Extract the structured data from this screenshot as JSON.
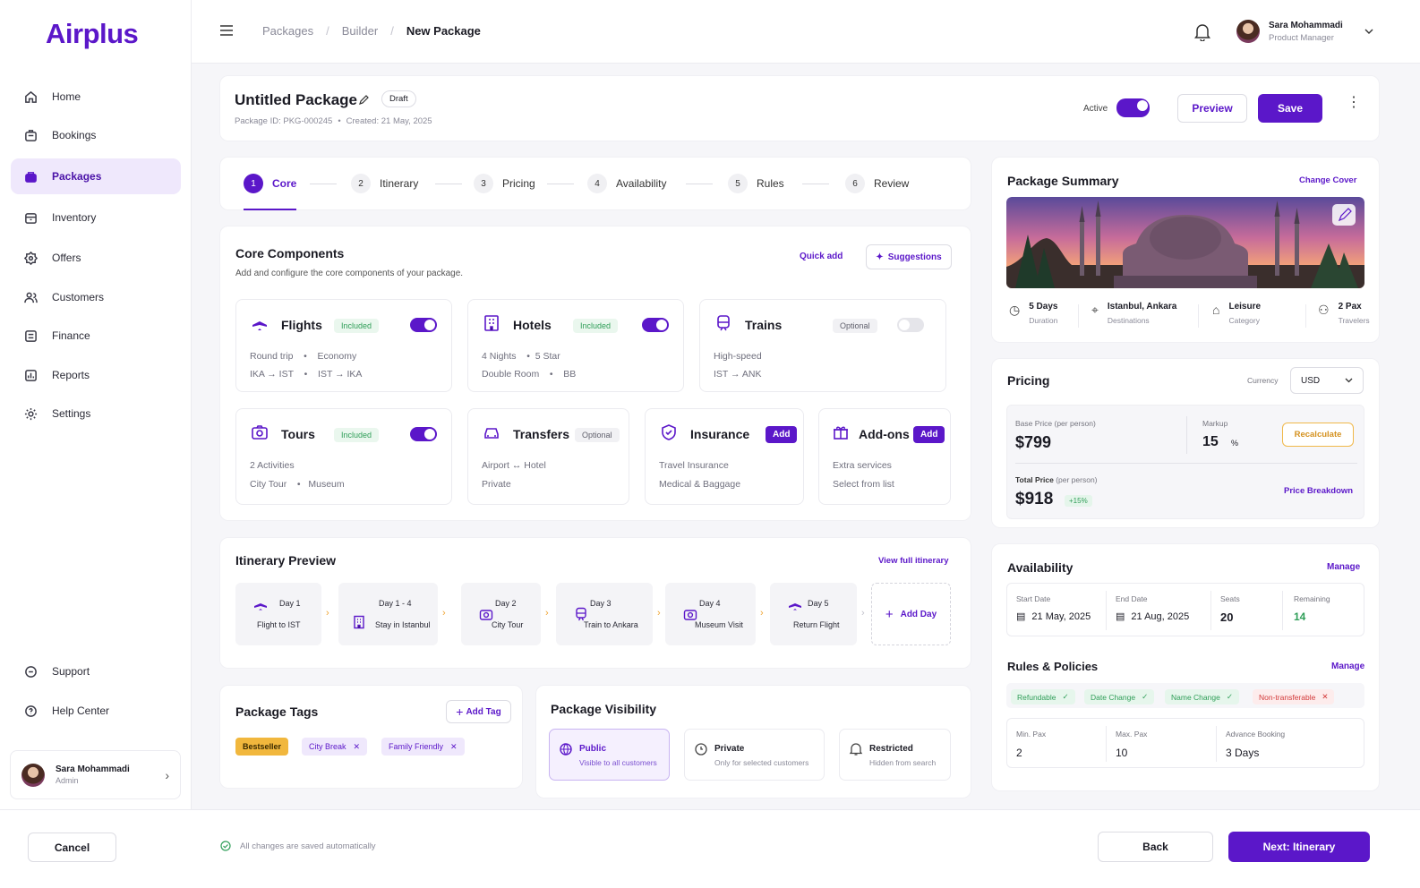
{
  "brand": {
    "name": "Airplus",
    "accent": "#5b17c9"
  },
  "sidebar": {
    "items": [
      {
        "label": "Home",
        "icon": "home-icon"
      },
      {
        "label": "Bookings",
        "icon": "briefcase-icon"
      },
      {
        "label": "Packages",
        "icon": "package-icon",
        "active": true
      },
      {
        "label": "Inventory",
        "icon": "inventory-icon"
      },
      {
        "label": "Offers",
        "icon": "badge-icon"
      },
      {
        "label": "Customers",
        "icon": "users-icon"
      },
      {
        "label": "Finance",
        "icon": "finance-icon"
      },
      {
        "label": "Reports",
        "icon": "reports-icon"
      },
      {
        "label": "Settings",
        "icon": "gear-icon"
      }
    ],
    "support": "Support",
    "help": "Help Center",
    "user": {
      "name": "Sara Mohammadi",
      "role": "Admin"
    }
  },
  "topbar": {
    "breadcrumbs": [
      "Packages",
      "Builder",
      "New Package"
    ],
    "user": {
      "name": "Sara Mohammadi",
      "role": "Product Manager"
    }
  },
  "header": {
    "title": "Untitled Package",
    "status": "Draft",
    "package_id": "Package ID: PKG-000245",
    "created": "Created: 21 May, 2025",
    "active_label": "Active",
    "preview": "Preview",
    "save": "Save"
  },
  "steps": [
    {
      "num": "1",
      "label": "Core"
    },
    {
      "num": "2",
      "label": "Itinerary"
    },
    {
      "num": "3",
      "label": "Pricing"
    },
    {
      "num": "4",
      "label": "Availability"
    },
    {
      "num": "5",
      "label": "Rules"
    },
    {
      "num": "6",
      "label": "Review"
    }
  ],
  "core": {
    "title": "Core Components",
    "subtitle": "Add and configure the core components of your package.",
    "quick_add": "Quick add",
    "suggestions": "Suggestions",
    "components": {
      "flights": {
        "title": "Flights",
        "badge": "Included",
        "l1a": "Round trip",
        "l1b": "Economy",
        "l2a": "IKA → IST",
        "l2b": "IST → IKA"
      },
      "hotels": {
        "title": "Hotels",
        "badge": "Included",
        "l1a": "4 Nights",
        "l1b": "5 Star",
        "l2a": "Double Room",
        "l2b": "BB"
      },
      "trains": {
        "title": "Trains",
        "badge": "Optional",
        "l1a": "High-speed",
        "l2a": "IST → ANK"
      },
      "tours": {
        "title": "Tours",
        "badge": "Included",
        "l1a": "2 Activities",
        "l2a": "City Tour",
        "l2b": "Museum"
      },
      "transfers": {
        "title": "Transfers",
        "badge": "Optional",
        "l1a": "Airport ↔ Hotel",
        "l2a": "Private"
      },
      "insurance": {
        "title": "Insurance",
        "badge": "Add",
        "l1a": "Travel Insurance",
        "l2a": "Medical & Baggage"
      },
      "addons": {
        "title": "Add-ons",
        "badge": "Add",
        "l1a": "Extra services",
        "l2a": "Select from list"
      }
    }
  },
  "itinerary": {
    "title": "Itinerary Preview",
    "view_full": "View full itinerary",
    "days": [
      {
        "day": "Day 1",
        "label": "Flight to IST"
      },
      {
        "day": "Day 1 - 4",
        "label": "Stay in Istanbul"
      },
      {
        "day": "Day 2",
        "label": "City Tour"
      },
      {
        "day": "Day 3",
        "label": "Train to Ankara"
      },
      {
        "day": "Day 4",
        "label": "Museum Visit"
      },
      {
        "day": "Day 5",
        "label": "Return Flight"
      }
    ],
    "add_day": "Add Day"
  },
  "tags": {
    "title": "Package Tags",
    "add": "Add Tag",
    "items": [
      "Bestseller",
      "City Break",
      "Family Friendly"
    ]
  },
  "visibility": {
    "title": "Package Visibility",
    "options": [
      {
        "title": "Public",
        "sub": "Visible to all customers"
      },
      {
        "title": "Private",
        "sub": "Only for selected customers"
      },
      {
        "title": "Restricted",
        "sub": "Hidden from search"
      }
    ]
  },
  "summary": {
    "title": "Package Summary",
    "change_cover": "Change Cover",
    "stats": [
      {
        "value": "5 Days",
        "label": "Duration"
      },
      {
        "value": "Istanbul, Ankara",
        "label": "Destinations"
      },
      {
        "value": "Leisure",
        "label": "Category"
      },
      {
        "value": "2 Pax",
        "label": "Travelers"
      }
    ]
  },
  "pricing": {
    "title": "Pricing",
    "currency_label": "Currency",
    "currency": "USD",
    "base_label": "Base Price",
    "per_person": "(per person)",
    "base": "$799",
    "markup_label": "Markup",
    "markup": "15",
    "pct": "%",
    "recalc": "Recalculate",
    "total_label": "Total Price",
    "total": "$918",
    "delta": "+15%",
    "breakdown": "Price Breakdown"
  },
  "availability": {
    "title": "Availability",
    "manage": "Manage",
    "start_label": "Start Date",
    "start": "21 May, 2025",
    "end_label": "End Date",
    "end": "21 Aug, 2025",
    "seats_label": "Seats",
    "seats": "20",
    "remaining_label": "Remaining",
    "remaining": "14"
  },
  "rules": {
    "title": "Rules & Policies",
    "manage": "Manage",
    "chips": [
      "Refundable",
      "Date Change",
      "Name Change",
      "Non-transferable"
    ],
    "min_label": "Min. Pax",
    "min": "2",
    "max_label": "Max. Pax",
    "max": "10",
    "adv_label": "Advance Booking",
    "adv": "3 Days"
  },
  "footer": {
    "cancel": "Cancel",
    "autosave": "All changes are saved automatically",
    "back": "Back",
    "next": "Next: Itinerary"
  }
}
